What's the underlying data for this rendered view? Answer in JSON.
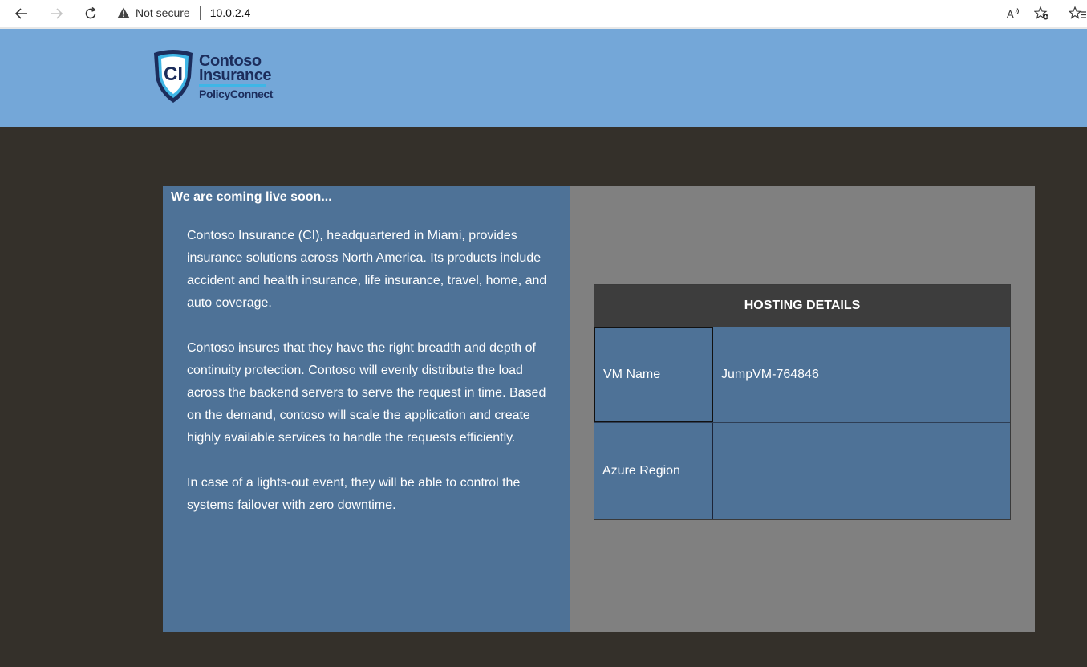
{
  "browser": {
    "security_label": "Not secure",
    "url": "10.0.2.4",
    "icons": {
      "back": "back-arrow-icon",
      "forward": "forward-arrow-icon",
      "refresh": "refresh-icon",
      "warning": "warning-triangle-icon",
      "read_aloud": "read-aloud-icon",
      "favorite": "add-favorite-icon",
      "favorites_list": "favorites-icon"
    }
  },
  "header": {
    "logo": {
      "line1": "Contoso",
      "line2": "Insurance",
      "line3": "PolicyConnect",
      "badge": "CI"
    },
    "background_color": "#74a7d8"
  },
  "main": {
    "heading": "We are coming live soon...",
    "paragraphs": [
      "Contoso Insurance (CI), headquartered in Miami, provides insurance solutions across North America. Its products include accident and health insurance, life insurance, travel, home, and auto coverage.",
      "Contoso insures that they have the right breadth and depth of continuity protection. Contoso will evenly distribute the load across the backend servers to serve the request in time. Based on the demand, contoso will scale the application and create highly available services to handle the requests efficiently.",
      "In case of a lights-out event, they will be able to control the systems failover with zero downtime."
    ]
  },
  "hosting": {
    "title": "HOSTING DETAILS",
    "rows": [
      {
        "label": "VM Name",
        "value": "JumpVM-764846"
      },
      {
        "label": "Azure Region",
        "value": ""
      }
    ]
  },
  "colors": {
    "page_background": "#34302a",
    "panel_blue": "#4e7297",
    "panel_gray": "#808080",
    "table_header": "#3d3d3d"
  }
}
